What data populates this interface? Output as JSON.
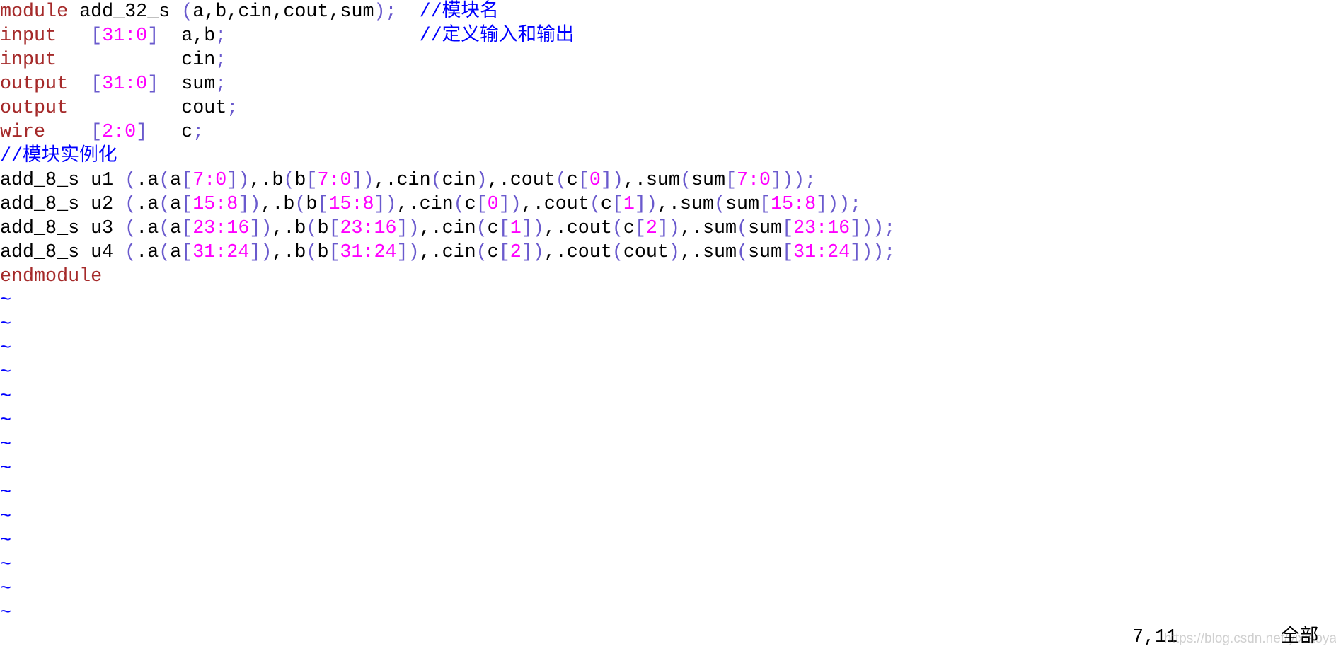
{
  "code": {
    "lines": [
      "module add_32_s (a,b,cin,cout,sum);  //模块名",
      "input   [31:0]  a,b;                 //定义输入和输出",
      "input           cin;",
      "output  [31:0]  sum;",
      "output          cout;",
      "wire    [2:0]   c;",
      "//模块实例化",
      "add_8_s u1 (.a(a[7:0]),.b(b[7:0]),.cin(cin),.cout(c[0]),.sum(sum[7:0]));",
      "add_8_s u2 (.a(a[15:8]),.b(b[15:8]),.cin(c[0]),.cout(c[1]),.sum(sum[15:8]));",
      "add_8_s u3 (.a(a[23:16]),.b(b[23:16]),.cin(c[1]),.cout(c[2]),.sum(sum[23:16]));",
      "add_8_s u4 (.a(a[31:24]),.b(b[31:24]),.cin(c[2]),.cout(cout),.sum(sum[31:24]));",
      "endmodule"
    ],
    "empty_line_marker": "~",
    "empty_line_count": 14
  },
  "status": {
    "cursor_position": "7,11",
    "scroll_position": "全部",
    "watermark": "https://blog.csdn.net/yixiaoyaod"
  },
  "colors": {
    "keyword": "#a52a2a",
    "number": "#ff00ff",
    "punctuation": "#6a5acd",
    "comment": "#0000ff",
    "text": "#000000"
  }
}
